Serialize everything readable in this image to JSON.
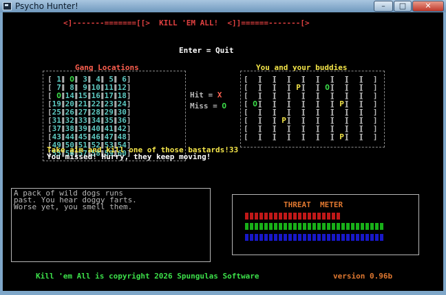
{
  "window": {
    "title": "Psycho Hunter!"
  },
  "header": {
    "banner": "<]-------=======[[>  KILL 'EM ALL!  <]]======-------[>",
    "quit_hint": "Enter = Quit"
  },
  "gang": {
    "title": "Gang Locations",
    "rows": [
      [
        "1",
        "O",
        "3",
        "4",
        "5",
        "6"
      ],
      [
        "7",
        "8",
        "9",
        "10",
        "11",
        "12"
      ],
      [
        "O",
        "14",
        "15",
        "16",
        "17",
        "18"
      ],
      [
        "19",
        "20",
        "21",
        "22",
        "23",
        "24"
      ],
      [
        "25",
        "26",
        "27",
        "28",
        "29",
        "30"
      ],
      [
        "31",
        "32",
        "33",
        "34",
        "35",
        "36"
      ],
      [
        "37",
        "38",
        "39",
        "40",
        "41",
        "42"
      ],
      [
        "43",
        "44",
        "45",
        "46",
        "47",
        "48"
      ],
      [
        "49",
        "50",
        "51",
        "52",
        "53",
        "54"
      ],
      [
        "55",
        "56",
        "57",
        "58",
        "59",
        "60"
      ]
    ]
  },
  "legend": {
    "hit_label": "Hit =",
    "hit_symbol": "X",
    "miss_label": "Miss =",
    "miss_symbol": "O"
  },
  "buddies": {
    "title": "You and your buddies",
    "rows": [
      [
        "",
        "",
        "",
        "",
        "",
        "",
        "",
        "",
        ""
      ],
      [
        "",
        "",
        "",
        "P",
        "",
        "O",
        "",
        "",
        ""
      ],
      [
        "",
        "",
        "",
        "",
        "",
        "",
        "",
        "",
        ""
      ],
      [
        "O",
        "",
        "",
        "",
        "",
        "",
        "P",
        "",
        ""
      ],
      [
        "",
        "",
        "",
        "",
        "",
        "",
        "",
        "",
        ""
      ],
      [
        "",
        "",
        "P",
        "",
        "",
        "",
        "",
        "",
        ""
      ],
      [
        "",
        "",
        "",
        "",
        "",
        "",
        "",
        "",
        ""
      ],
      [
        "",
        "",
        "",
        "",
        "",
        "",
        "P",
        "",
        ""
      ]
    ]
  },
  "messages": {
    "line1": "Take aim and kill one of those bastards!33",
    "line2": "You missed! Hurry, they keep moving!"
  },
  "story": {
    "lines": [
      "A pack of wild dogs runs",
      "past. You hear doggy farts.",
      "Worse yet, you smell them."
    ]
  },
  "threat": {
    "title": "THREAT  METER",
    "red_count": 20,
    "green_count": 29,
    "blue_count": 29,
    "colors": {
      "red": "#c01818",
      "green": "#18b018",
      "blue": "#1818c8"
    }
  },
  "footer": {
    "copyright": "Kill 'em All is copyright 2026 Spungulas Software",
    "version": "version 0.96b"
  }
}
